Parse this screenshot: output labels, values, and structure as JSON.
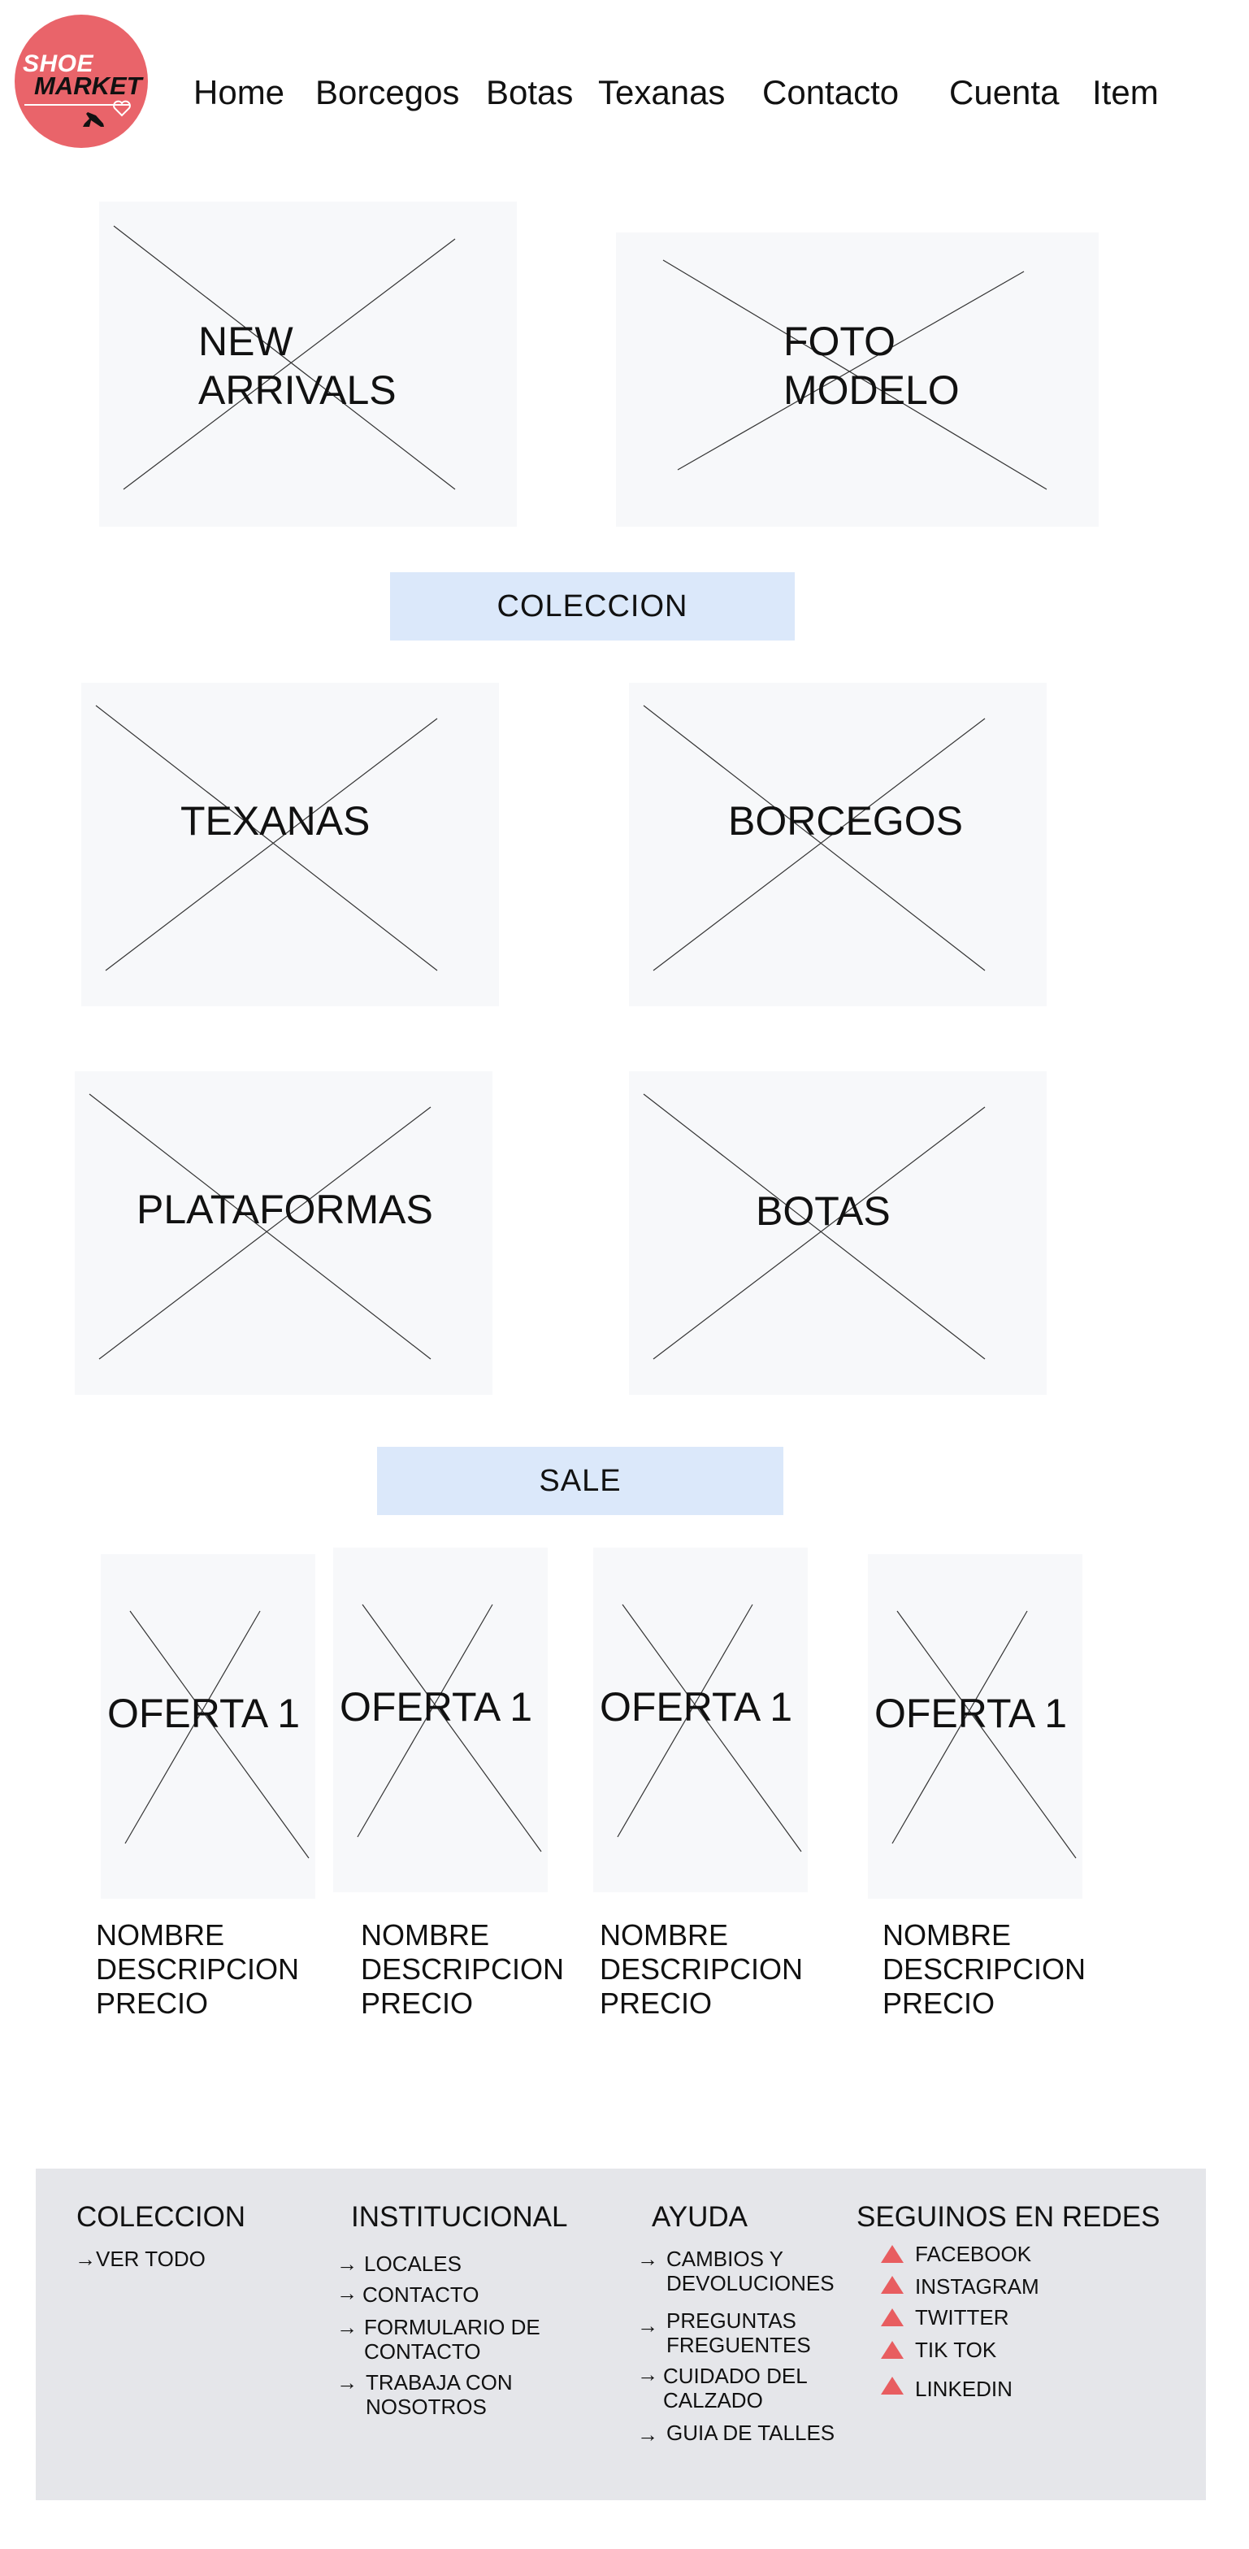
{
  "logo": {
    "line1": "SHOE",
    "line2": "MARKET"
  },
  "nav": {
    "items": [
      {
        "label": "Home"
      },
      {
        "label": "Borcegos"
      },
      {
        "label": "Botas"
      },
      {
        "label": "Texanas"
      },
      {
        "label": "Contacto"
      },
      {
        "label": "Cuenta"
      },
      {
        "label": "Item"
      }
    ]
  },
  "hero": {
    "new_arrivals": [
      "NEW",
      "ARRIVALS"
    ],
    "foto_modelo": [
      "FOTO",
      "MODELO"
    ]
  },
  "coleccion": {
    "title": "COLECCION",
    "items": [
      {
        "label": "TEXANAS"
      },
      {
        "label": "BORCEGOS"
      },
      {
        "label": "PLATAFORMAS"
      },
      {
        "label": "BOTAS"
      }
    ]
  },
  "sale": {
    "title": "SALE",
    "products": [
      {
        "image_label": "OFERTA 1",
        "name": "NOMBRE",
        "description": "DESCRIPCION",
        "price": "PRECIO"
      },
      {
        "image_label": "OFERTA 1",
        "name": "NOMBRE",
        "description": "DESCRIPCION",
        "price": "PRECIO"
      },
      {
        "image_label": "OFERTA 1",
        "name": "NOMBRE",
        "description": "DESCRIPCION",
        "price": "PRECIO"
      },
      {
        "image_label": "OFERTA 1",
        "name": "NOMBRE",
        "description": "DESCRIPCION",
        "price": "PRECIO"
      }
    ]
  },
  "footer": {
    "coleccion": {
      "title": "COLECCION",
      "links": [
        "VER TODO"
      ]
    },
    "institucional": {
      "title": "INSTITUCIONAL",
      "links": [
        [
          "LOCALES"
        ],
        [
          "CONTACTO"
        ],
        [
          "FORMULARIO DE",
          "CONTACTO"
        ],
        [
          "TRABAJA CON",
          "NOSOTROS"
        ]
      ]
    },
    "ayuda": {
      "title": "AYUDA",
      "links": [
        [
          "CAMBIOS Y",
          "DEVOLUCIONES"
        ],
        [
          "PREGUNTAS",
          "FREGUENTES"
        ],
        [
          "CUIDADO DEL",
          "CALZADO"
        ],
        [
          "GUIA DE TALLES"
        ]
      ]
    },
    "redes": {
      "title": "SEGUINOS EN REDES",
      "links": [
        "FACEBOOK",
        "INSTAGRAM",
        "TWITTER",
        "TIK TOK",
        "LINKEDIN"
      ]
    }
  },
  "colors": {
    "logo": "#e9646a",
    "section_bar": "#dbe8fa",
    "footer_bg": "#e5e6ea",
    "social_icon": "#e85d60",
    "placeholder_bg": "#f7f8fa"
  }
}
